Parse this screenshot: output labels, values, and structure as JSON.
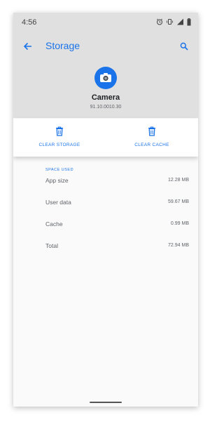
{
  "status_bar": {
    "time": "4:56"
  },
  "toolbar": {
    "title": "Storage"
  },
  "app": {
    "name": "Camera",
    "version": "91.10.0010.30"
  },
  "actions": {
    "clear_storage": "CLEAR STORAGE",
    "clear_cache": "CLEAR CACHE"
  },
  "space_used": {
    "heading": "SPACE USED",
    "rows": [
      {
        "label": "App size",
        "value": "12.28 MB"
      },
      {
        "label": "User data",
        "value": "59.67 MB"
      },
      {
        "label": "Cache",
        "value": "0.99 MB"
      },
      {
        "label": "Total",
        "value": "72.94 MB"
      }
    ]
  },
  "colors": {
    "accent": "#1a73e8",
    "header_bg": "#e0e0e0"
  },
  "icons": [
    "back-arrow-icon",
    "search-icon",
    "camera-icon",
    "trash-icon"
  ]
}
